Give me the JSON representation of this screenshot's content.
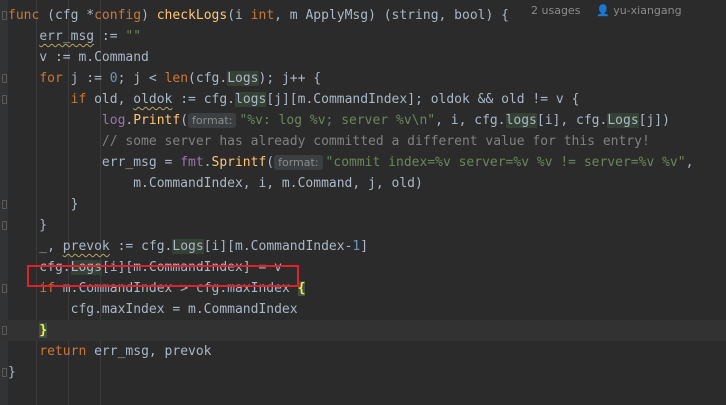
{
  "editor": {
    "lines": [
      {
        "segs": [
          [
            "kw",
            "func"
          ],
          [
            "p",
            " (cfg *"
          ],
          [
            "typ",
            "config"
          ],
          [
            "p",
            ") "
          ],
          [
            "fn",
            "checkLogs"
          ],
          [
            "p",
            "(i "
          ],
          [
            "typ",
            "int"
          ],
          [
            "p",
            ", m ApplyMsg) (string, bool) {"
          ]
        ]
      },
      {
        "segs": [
          [
            "p",
            "    "
          ],
          [
            "squig",
            "err_msg"
          ],
          [
            "p",
            " := "
          ],
          [
            "str",
            "\"\""
          ]
        ]
      },
      {
        "segs": [
          [
            "p",
            "    v := m.Command"
          ]
        ]
      },
      {
        "segs": [
          [
            "p",
            "    "
          ],
          [
            "kw",
            "for"
          ],
          [
            "p",
            " j := "
          ],
          [
            "num",
            "0"
          ],
          [
            "p",
            "; j < "
          ],
          [
            "kw",
            "len"
          ],
          [
            "p",
            "(cfg."
          ],
          [
            "hlfield",
            "Logs"
          ],
          [
            "p",
            "); j++ {"
          ]
        ]
      },
      {
        "segs": [
          [
            "p",
            "        "
          ],
          [
            "kw",
            "if"
          ],
          [
            "p",
            " old, "
          ],
          [
            "squig",
            "oldok"
          ],
          [
            "p",
            " := cfg."
          ],
          [
            "hlfield",
            "logs"
          ],
          [
            "p",
            "[j][m.CommandIndex]; oldok && old != v {"
          ]
        ]
      },
      {
        "segs": [
          [
            "p",
            "            "
          ],
          [
            "field",
            "log"
          ],
          [
            "p",
            "."
          ],
          [
            "fn",
            "Printf"
          ],
          [
            "p",
            "("
          ],
          [
            "hint",
            "format:"
          ],
          [
            "str",
            "\"%v: log %v; server %v\\n\""
          ],
          [
            "p",
            ", i, cfg."
          ],
          [
            "hlfield",
            "logs"
          ],
          [
            "p",
            "[i], cfg."
          ],
          [
            "hlfield",
            "Logs"
          ],
          [
            "p",
            "[j])"
          ]
        ]
      },
      {
        "segs": [
          [
            "p",
            "            "
          ],
          [
            "cmt",
            "// some server has already committed a different value for this entry!"
          ]
        ]
      },
      {
        "segs": [
          [
            "p",
            "            err_msg = "
          ],
          [
            "field",
            "fmt"
          ],
          [
            "p",
            "."
          ],
          [
            "fn",
            "Sprintf"
          ],
          [
            "p",
            "("
          ],
          [
            "hint",
            "format:"
          ],
          [
            "str",
            "\"commit index=%v server=%v %v != server=%v %v\""
          ],
          [
            "p",
            ","
          ]
        ]
      },
      {
        "segs": [
          [
            "p",
            "                m.CommandIndex, i, m.Command, j, old)"
          ]
        ]
      },
      {
        "segs": [
          [
            "p",
            "        }"
          ]
        ]
      },
      {
        "segs": [
          [
            "p",
            "    }"
          ]
        ]
      },
      {
        "segs": [
          [
            "p",
            "    _, "
          ],
          [
            "squig",
            "prevok"
          ],
          [
            "p",
            " := cfg."
          ],
          [
            "hlfield",
            "Logs"
          ],
          [
            "p",
            "[i][m.CommandIndex-"
          ],
          [
            "num",
            "1"
          ],
          [
            "p",
            "]"
          ]
        ]
      },
      {
        "segs": [
          [
            "p",
            "    cfg."
          ],
          [
            "hlfield",
            "Logs"
          ],
          [
            "p",
            "[i][m.CommandIndex] = v"
          ]
        ]
      },
      {
        "segs": [
          [
            "p",
            "    "
          ],
          [
            "kw",
            "if"
          ],
          [
            "p",
            " m.CommandIndex > cfg.maxIndex "
          ],
          [
            "bracket",
            "{"
          ]
        ]
      },
      {
        "segs": [
          [
            "p",
            "        cfg.maxIndex = m.CommandIndex"
          ]
        ]
      },
      {
        "segs": [
          [
            "p",
            "    "
          ],
          [
            "bracket",
            "}"
          ]
        ]
      },
      {
        "segs": [
          [
            "p",
            "    "
          ],
          [
            "kw",
            "return"
          ],
          [
            "p",
            " err_msg, prevok"
          ]
        ]
      },
      {
        "segs": [
          [
            "p",
            "}"
          ]
        ]
      }
    ],
    "usages": "2 usages",
    "author": "yu-xiangang",
    "current_line": 15
  }
}
